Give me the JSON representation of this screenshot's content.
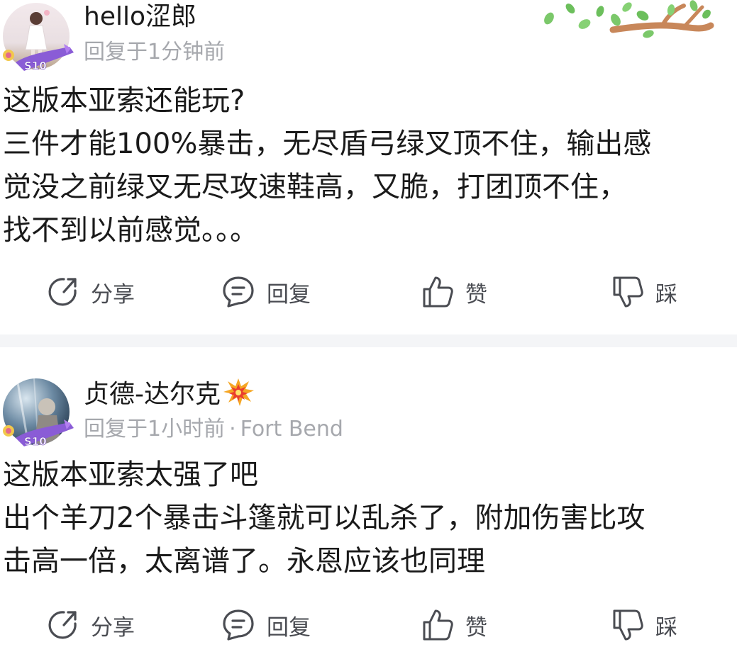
{
  "posts": [
    {
      "username": "hello涩郎",
      "meta": "回复于1分钟前",
      "location": "",
      "content_lines": [
        "这版本亚索还能玩?",
        "三件才能100%暴击，无尽盾弓绿叉顶不住，输出感",
        "觉没之前绿叉无尽攻速鞋高，又脆，打团顶不住，",
        "找不到以前感觉。。。"
      ],
      "badge_text": "S10",
      "actions": {
        "share": "分享",
        "reply": "回复",
        "like": "赞",
        "dislike": "踩"
      }
    },
    {
      "username": "贞德-达尔克",
      "meta": "回复于1小时前",
      "location": "Fort Bend",
      "content_lines": [
        "这版本亚索太强了吧",
        "出个羊刀2个暴击斗篷就可以乱杀了，附加伤害比攻",
        "击高一倍，太离谱了。永恩应该也同理"
      ],
      "badge_text": "S10",
      "actions": {
        "share": "分享",
        "reply": "回复",
        "like": "赞",
        "dislike": "踩"
      }
    }
  ],
  "meta_separator": "·",
  "colors": {
    "text": "#1a1a1a",
    "meta": "#a6a8ad",
    "action_text": "#4a4c52",
    "separator": "#f4f5f7",
    "badge": "#8a5cd6"
  },
  "icons": {
    "share": "share-icon",
    "reply": "comment-icon",
    "like": "thumbs-up-icon",
    "dislike": "thumbs-down-icon",
    "decoration": "tree-branch-decoration",
    "username_emoji": "collision-emoji-icon"
  }
}
